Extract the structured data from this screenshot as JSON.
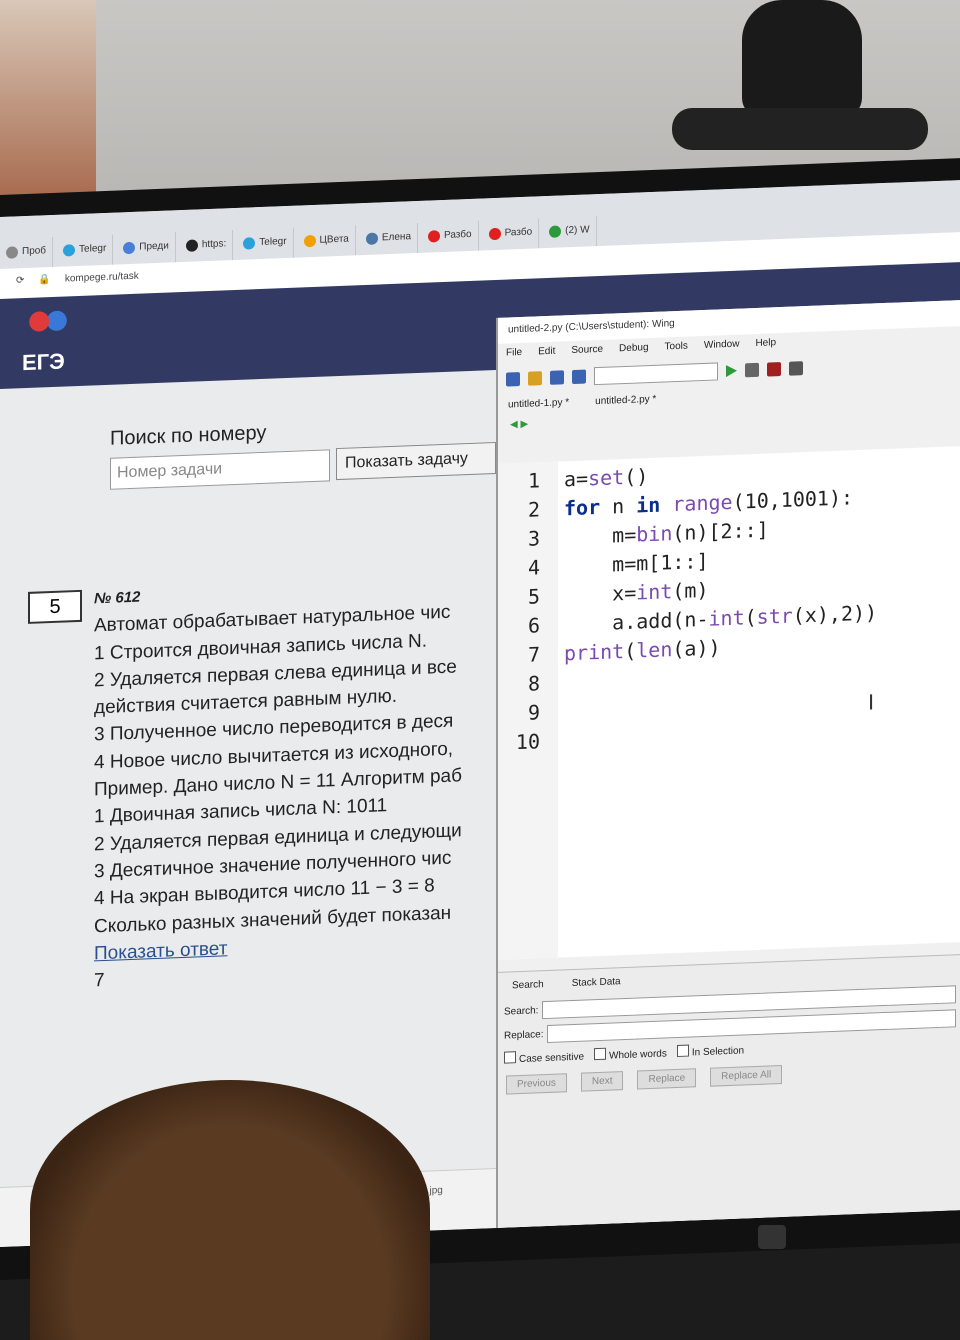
{
  "browser": {
    "tabs": [
      "Проб",
      "Telegr",
      "Преди",
      "https:",
      "Telegr",
      "ЦВета",
      "Елена",
      "Разбо",
      "Разбо",
      "(2) W"
    ],
    "url": "kompege.ru/task"
  },
  "site": {
    "logo_text": "ЕГЭ",
    "search_title": "Поиск по номеру",
    "search_placeholder": "Номер задачи",
    "search_button": "Показать задачу"
  },
  "task": {
    "box_number": "5",
    "id": "№ 612",
    "lines": [
      "Автомат обрабатывает натуральное чис",
      "1 Строится двоичная запись числа N.",
      "2 Удаляется первая слева единица и все",
      "действия считается равным нулю.",
      "3 Полученное число переводится в деся",
      "4 Новое число вычитается из исходного,",
      "Пример. Дано число N = 11 Алгоритм раб",
      "1 Двоичная запись числа N: 1011",
      "2 Удаляется первая единица и следующи",
      "3 Десятичное значение полученного чис",
      "4 На экран выводится число 11 − 3 = 8",
      "Сколько разных значений будет показан"
    ],
    "show_answer": "Показать ответ",
    "answer": "7",
    "download_file": "IMG_6160.jpg"
  },
  "ide": {
    "title": "untitled-2.py (C:\\Users\\student): Wing",
    "menu": [
      "File",
      "Edit",
      "Source",
      "Debug",
      "Tools",
      "Window",
      "Help"
    ],
    "files": [
      "untitled-1.py *",
      "untitled-2.py *"
    ],
    "line_numbers": [
      "1",
      "2",
      "3",
      "4",
      "5",
      "6",
      "7",
      "8",
      "9",
      "10"
    ],
    "search_tabs": [
      "Search",
      "Stack Data"
    ],
    "search_label": "Search:",
    "replace_label": "Replace:",
    "checks": [
      "Case sensitive",
      "Whole words",
      "In Selection"
    ],
    "buttons": [
      "Previous",
      "Next",
      "Replace",
      "Replace All"
    ]
  },
  "colors": {
    "header": "#323a63",
    "keyword": "#0b2d8c",
    "builtin": "#7a4ab0"
  }
}
